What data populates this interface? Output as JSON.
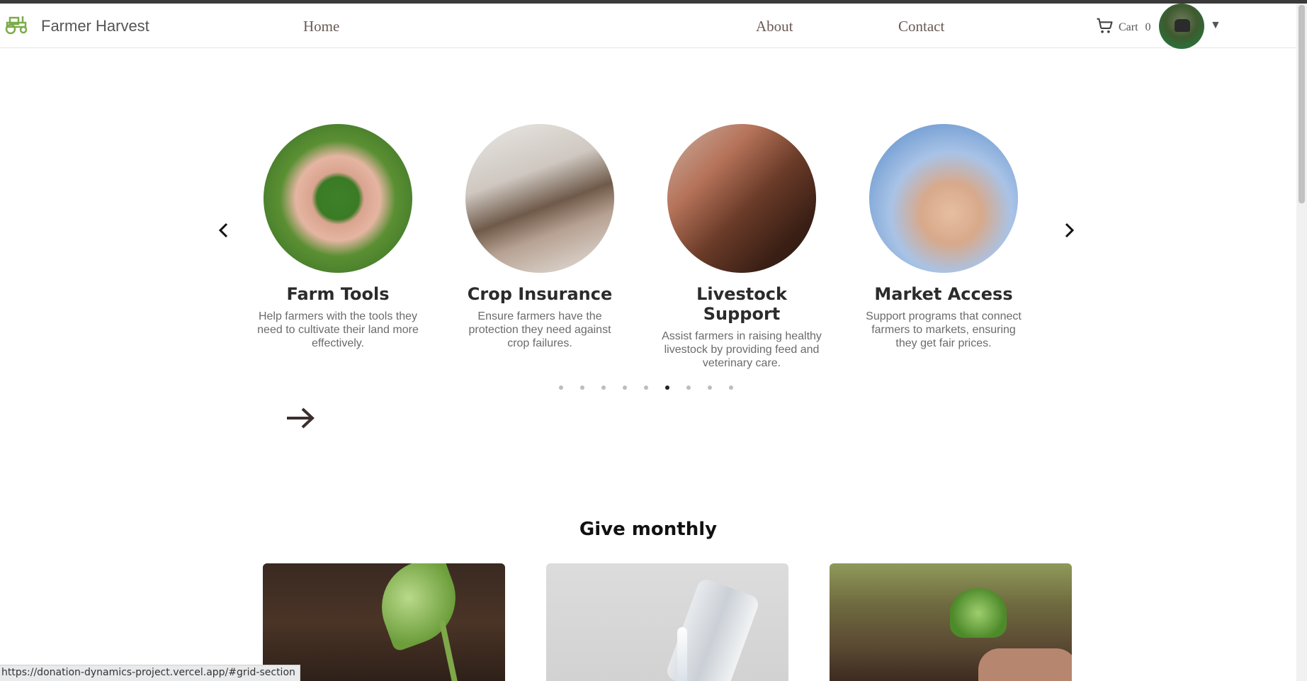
{
  "brand": {
    "name": "Farmer Harvest",
    "logo_icon": "tractor-icon",
    "color": "#7cab4b"
  },
  "nav": {
    "home": "Home",
    "about": "About",
    "contact": "Contact"
  },
  "cart": {
    "label": "Cart",
    "count": "0",
    "icon": "cart-icon"
  },
  "user_menu": {
    "caret": "▼"
  },
  "carousel": {
    "prev_icon": "chevron-left-icon",
    "next_icon": "chevron-right-icon",
    "cards": [
      {
        "title": "Farm Tools",
        "description": "Help farmers with the tools they need to cultivate their land more effectively."
      },
      {
        "title": "Crop Insurance",
        "description": "Ensure farmers have the protection they need against crop failures."
      },
      {
        "title": "Livestock Support",
        "description": "Assist farmers in raising healthy livestock by providing feed and veterinary care."
      },
      {
        "title": "Market Access",
        "description": "Support programs that connect farmers to markets, ensuring they get fair prices."
      }
    ],
    "dots_total": 9,
    "active_dot_index": 5
  },
  "section": {
    "title": "Give monthly"
  },
  "status_url": "https://donation-dynamics-project.vercel.app/#grid-section"
}
